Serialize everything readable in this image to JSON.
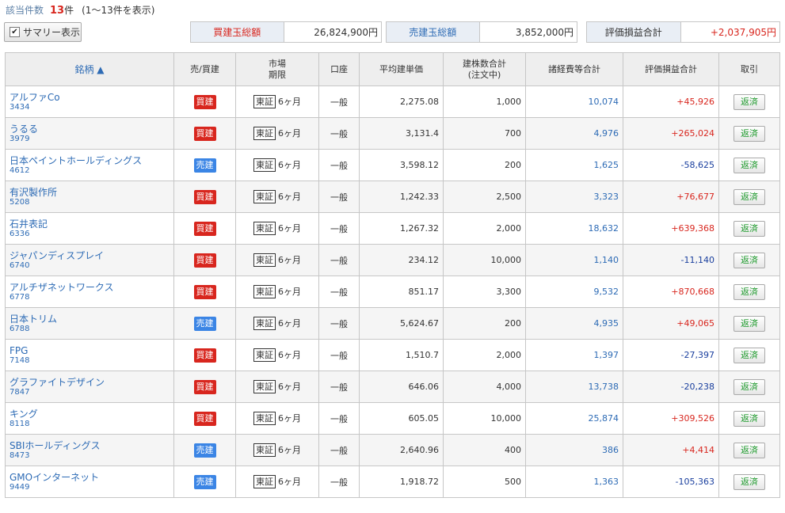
{
  "header": {
    "count_label": "該当件数",
    "count_value": "13",
    "count_unit": "件",
    "range_text": "(1～13件を表示)"
  },
  "summary_toggle": {
    "label": "サマリー表示",
    "checked": true
  },
  "summary": {
    "buy_total_label": "買建玉総額",
    "buy_total_value": "26,824,900円",
    "sell_total_label": "売建玉総額",
    "sell_total_value": "3,852,000円",
    "pl_total_label": "評価損益合計",
    "pl_total_value": "+2,037,905円"
  },
  "table": {
    "headers": {
      "name": "銘柄 ▲",
      "side": "売/買建",
      "market_l1": "市場",
      "market_l2": "期限",
      "account": "口座",
      "avg_price": "平均建単価",
      "qty_l1": "建株数合計",
      "qty_l2": "(注文中)",
      "fees": "諸経費等合計",
      "pl": "評価損益合計",
      "trade": "取引"
    },
    "rows": [
      {
        "name": "アルファCo",
        "code": "3434",
        "side": "買建",
        "side_type": "buy",
        "market": "東証",
        "term": "6ヶ月",
        "account": "一般",
        "avg_price": "2,275.08",
        "qty": "1,000",
        "fees": "10,074",
        "pl": "+45,926",
        "pl_sign": "pos",
        "action": "返済"
      },
      {
        "name": "うるる",
        "code": "3979",
        "side": "買建",
        "side_type": "buy",
        "market": "東証",
        "term": "6ヶ月",
        "account": "一般",
        "avg_price": "3,131.4",
        "qty": "700",
        "fees": "4,976",
        "pl": "+265,024",
        "pl_sign": "pos",
        "action": "返済"
      },
      {
        "name": "日本ペイントホールディングス",
        "code": "4612",
        "side": "売建",
        "side_type": "sell",
        "market": "東証",
        "term": "6ヶ月",
        "account": "一般",
        "avg_price": "3,598.12",
        "qty": "200",
        "fees": "1,625",
        "pl": "-58,625",
        "pl_sign": "neg",
        "action": "返済"
      },
      {
        "name": "有沢製作所",
        "code": "5208",
        "side": "買建",
        "side_type": "buy",
        "market": "東証",
        "term": "6ヶ月",
        "account": "一般",
        "avg_price": "1,242.33",
        "qty": "2,500",
        "fees": "3,323",
        "pl": "+76,677",
        "pl_sign": "pos",
        "action": "返済"
      },
      {
        "name": "石井表記",
        "code": "6336",
        "side": "買建",
        "side_type": "buy",
        "market": "東証",
        "term": "6ヶ月",
        "account": "一般",
        "avg_price": "1,267.32",
        "qty": "2,000",
        "fees": "18,632",
        "pl": "+639,368",
        "pl_sign": "pos",
        "action": "返済"
      },
      {
        "name": "ジャパンディスプレイ",
        "code": "6740",
        "side": "買建",
        "side_type": "buy",
        "market": "東証",
        "term": "6ヶ月",
        "account": "一般",
        "avg_price": "234.12",
        "qty": "10,000",
        "fees": "1,140",
        "pl": "-11,140",
        "pl_sign": "neg",
        "action": "返済"
      },
      {
        "name": "アルチザネットワークス",
        "code": "6778",
        "side": "買建",
        "side_type": "buy",
        "market": "東証",
        "term": "6ヶ月",
        "account": "一般",
        "avg_price": "851.17",
        "qty": "3,300",
        "fees": "9,532",
        "pl": "+870,668",
        "pl_sign": "pos",
        "action": "返済"
      },
      {
        "name": "日本トリム",
        "code": "6788",
        "side": "売建",
        "side_type": "sell",
        "market": "東証",
        "term": "6ヶ月",
        "account": "一般",
        "avg_price": "5,624.67",
        "qty": "200",
        "fees": "4,935",
        "pl": "+49,065",
        "pl_sign": "pos",
        "action": "返済"
      },
      {
        "name": "FPG",
        "code": "7148",
        "side": "買建",
        "side_type": "buy",
        "market": "東証",
        "term": "6ヶ月",
        "account": "一般",
        "avg_price": "1,510.7",
        "qty": "2,000",
        "fees": "1,397",
        "pl": "-27,397",
        "pl_sign": "neg",
        "action": "返済"
      },
      {
        "name": "グラファイトデザイン",
        "code": "7847",
        "side": "買建",
        "side_type": "buy",
        "market": "東証",
        "term": "6ヶ月",
        "account": "一般",
        "avg_price": "646.06",
        "qty": "4,000",
        "fees": "13,738",
        "pl": "-20,238",
        "pl_sign": "neg",
        "action": "返済"
      },
      {
        "name": "キング",
        "code": "8118",
        "side": "買建",
        "side_type": "buy",
        "market": "東証",
        "term": "6ヶ月",
        "account": "一般",
        "avg_price": "605.05",
        "qty": "10,000",
        "fees": "25,874",
        "pl": "+309,526",
        "pl_sign": "pos",
        "action": "返済"
      },
      {
        "name": "SBIホールディングス",
        "code": "8473",
        "side": "売建",
        "side_type": "sell",
        "market": "東証",
        "term": "6ヶ月",
        "account": "一般",
        "avg_price": "2,640.96",
        "qty": "400",
        "fees": "386",
        "pl": "+4,414",
        "pl_sign": "pos",
        "action": "返済"
      },
      {
        "name": "GMOインターネット",
        "code": "9449",
        "side": "売建",
        "side_type": "sell",
        "market": "東証",
        "term": "6ヶ月",
        "account": "一般",
        "avg_price": "1,918.72",
        "qty": "500",
        "fees": "1,363",
        "pl": "-105,363",
        "pl_sign": "neg",
        "action": "返済"
      }
    ]
  },
  "colors": {
    "buy": "#d8261e",
    "sell": "#3b85e5",
    "link": "#2d6bb5",
    "negative": "#1a3f9e",
    "action_text": "#1e9a2c"
  }
}
